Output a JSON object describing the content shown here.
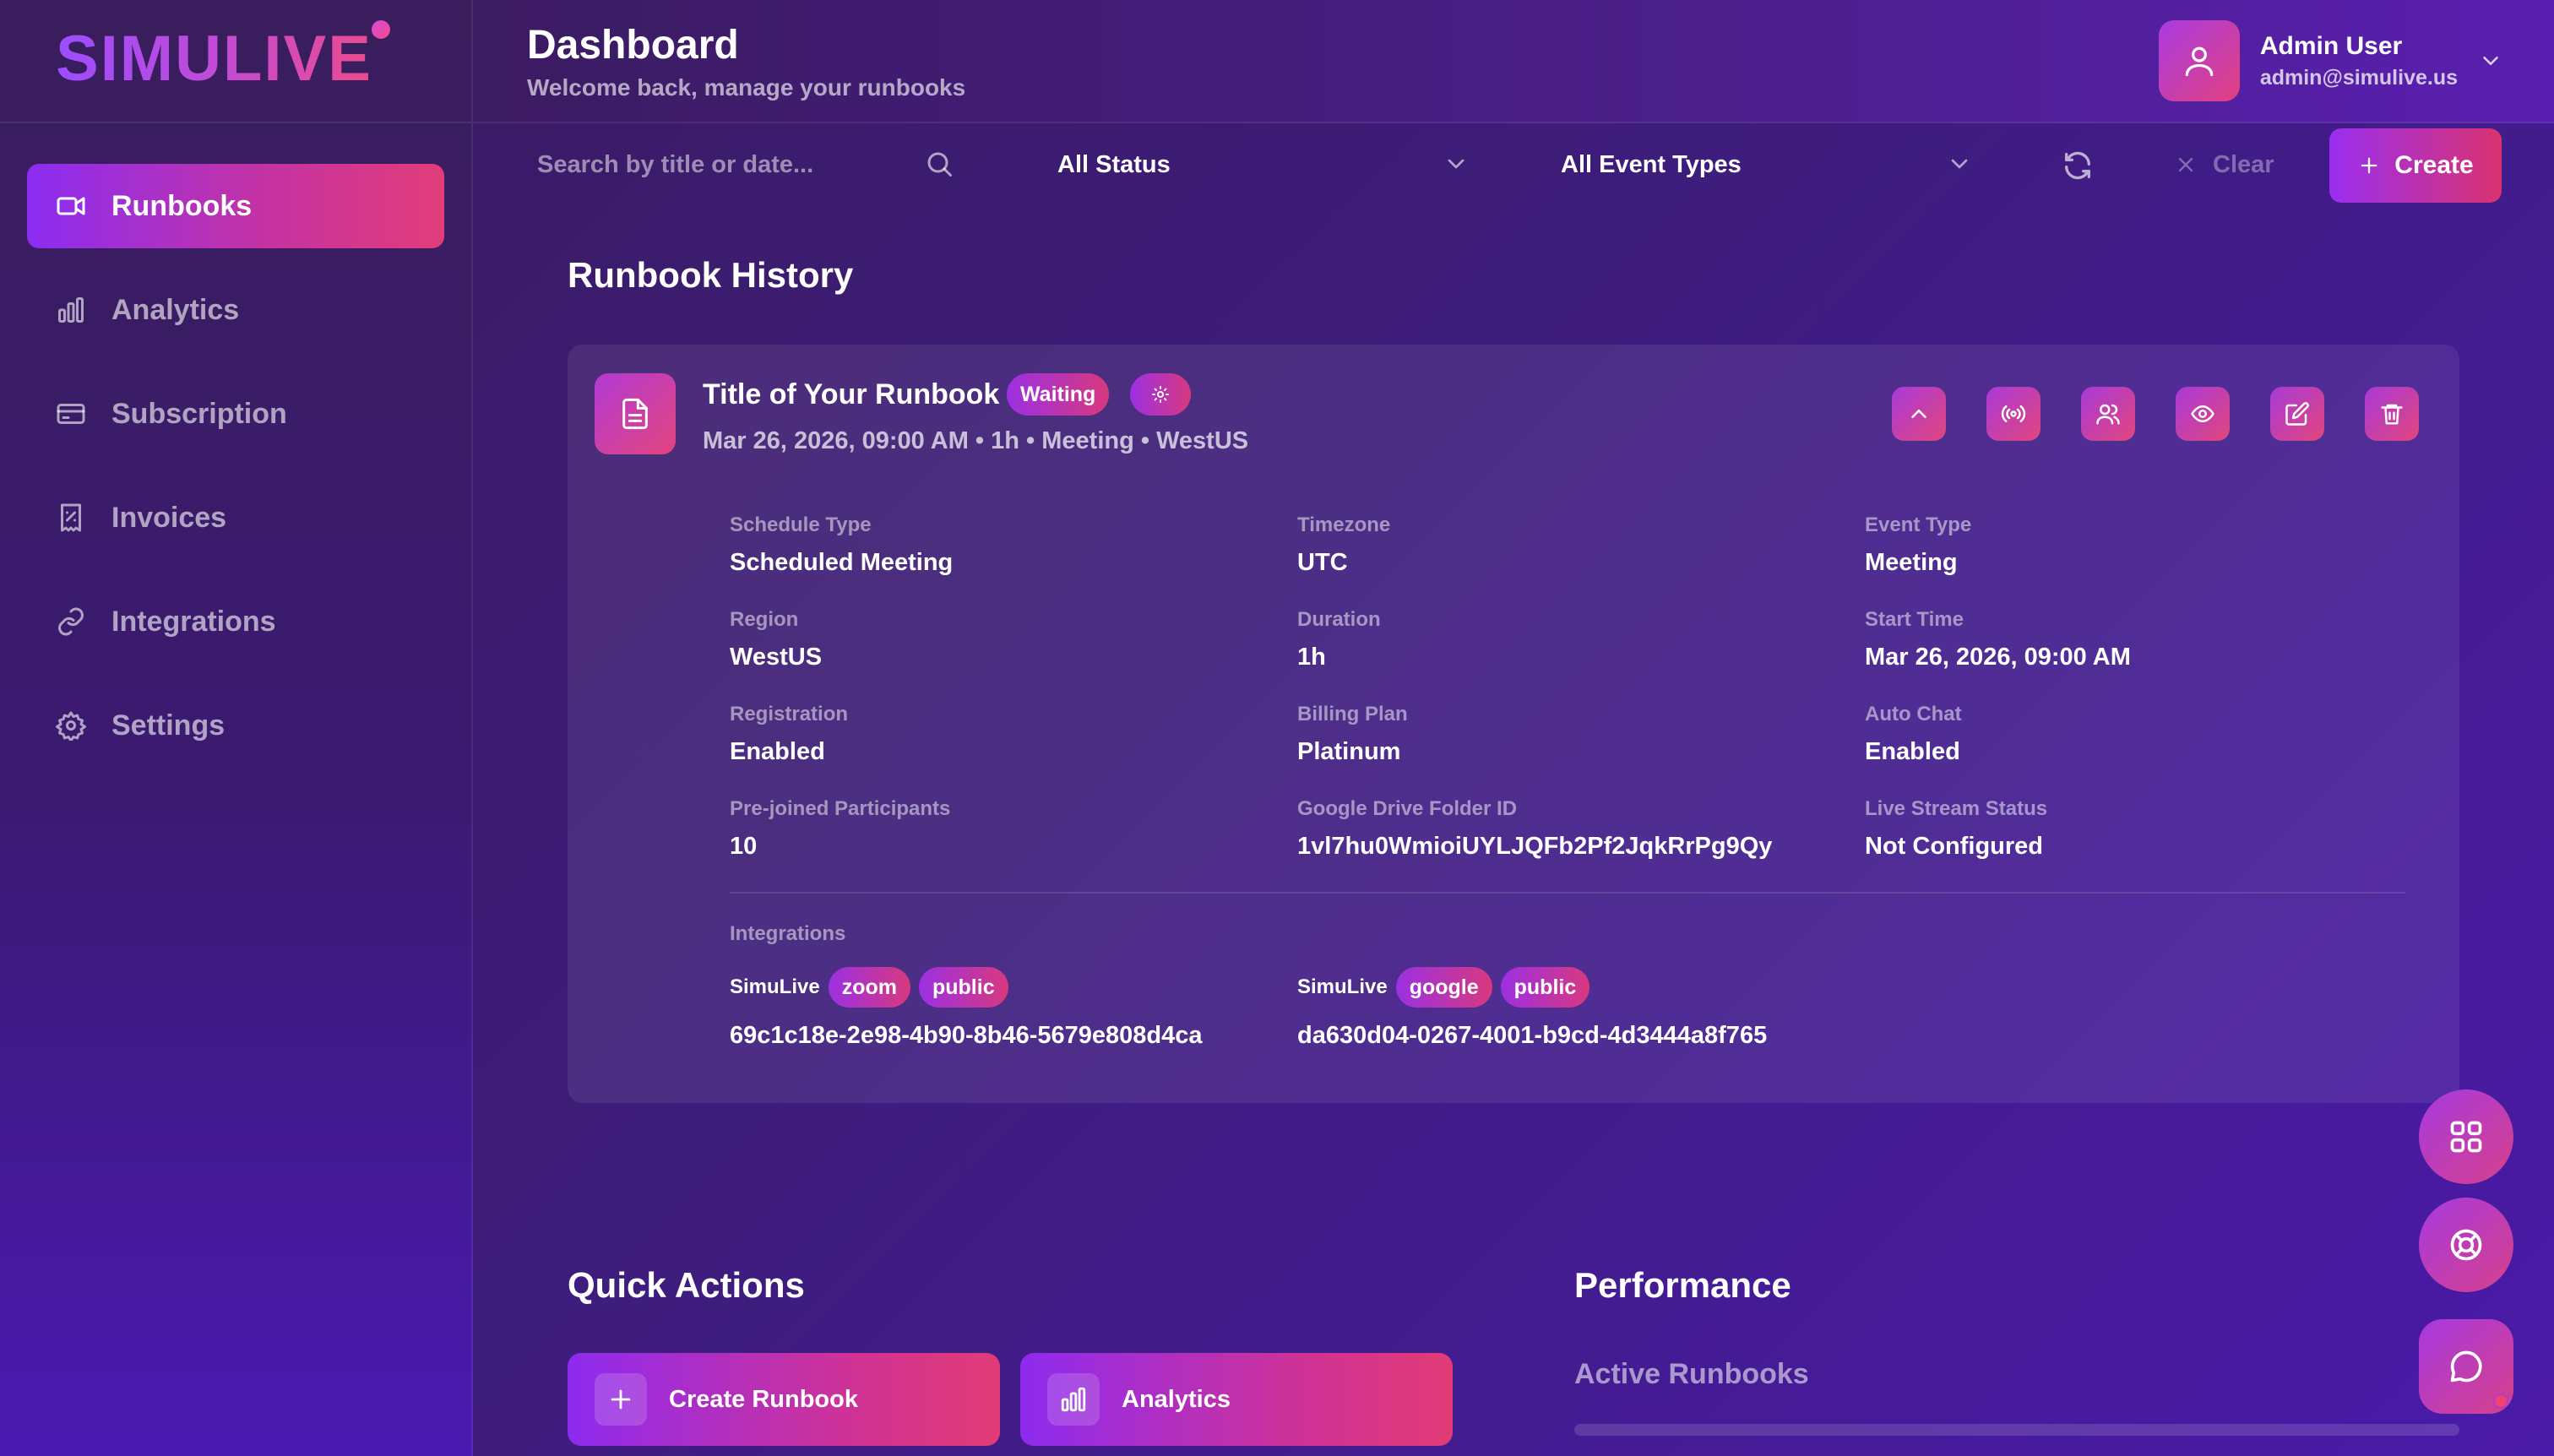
{
  "app": {
    "logo_text": "SIMULIVE"
  },
  "sidebar": {
    "items": [
      {
        "label": "Runbooks",
        "icon": "video-icon",
        "active": true
      },
      {
        "label": "Analytics",
        "icon": "bar-chart-icon"
      },
      {
        "label": "Subscription",
        "icon": "credit-card-icon"
      },
      {
        "label": "Invoices",
        "icon": "receipt-icon"
      },
      {
        "label": "Integrations",
        "icon": "link-icon"
      },
      {
        "label": "Settings",
        "icon": "gear-icon"
      }
    ]
  },
  "header": {
    "title": "Dashboard",
    "subtitle": "Welcome back, manage your runbooks",
    "user": {
      "name": "Admin User",
      "email": "admin@simulive.us"
    }
  },
  "toolbar": {
    "search_placeholder": "Search by title or date...",
    "status_filter": "All Status",
    "event_type_filter": "All Event Types",
    "clear_label": "Clear",
    "create_label": "Create"
  },
  "history": {
    "title": "Runbook History",
    "runbook": {
      "title": "Title of Your Runbook",
      "status": "Waiting",
      "meta": "Mar 26, 2026, 09:00 AM • 1h • Meeting • WestUS",
      "fields": [
        {
          "label": "Schedule Type",
          "value": "Scheduled Meeting"
        },
        {
          "label": "Timezone",
          "value": "UTC"
        },
        {
          "label": "Event Type",
          "value": "Meeting"
        },
        {
          "label": "Region",
          "value": "WestUS"
        },
        {
          "label": "Duration",
          "value": "1h"
        },
        {
          "label": "Start Time",
          "value": "Mar 26, 2026, 09:00 AM"
        },
        {
          "label": "Registration",
          "value": "Enabled"
        },
        {
          "label": "Billing Plan",
          "value": "Platinum"
        },
        {
          "label": "Auto Chat",
          "value": "Enabled"
        },
        {
          "label": "Pre-joined Participants",
          "value": "10"
        },
        {
          "label": "Google Drive Folder ID",
          "value": "1vl7hu0WmioiUYLJQFb2Pf2JqkRrPg9Qy"
        },
        {
          "label": "Live Stream Status",
          "value": "Not Configured"
        }
      ],
      "integrations_label": "Integrations",
      "integrations": [
        {
          "name": "SimuLive",
          "tags": [
            "zoom",
            "public"
          ],
          "id": "69c1c18e-2e98-4b90-8b46-5679e808d4ca"
        },
        {
          "name": "SimuLive",
          "tags": [
            "google",
            "public"
          ],
          "id": "da630d04-0267-4001-b9cd-4d3444a8f765"
        }
      ]
    }
  },
  "quick_actions": {
    "title": "Quick Actions",
    "create_runbook": "Create Runbook",
    "analytics": "Analytics"
  },
  "performance": {
    "title": "Performance",
    "active_runbooks": "Active Runbooks"
  }
}
